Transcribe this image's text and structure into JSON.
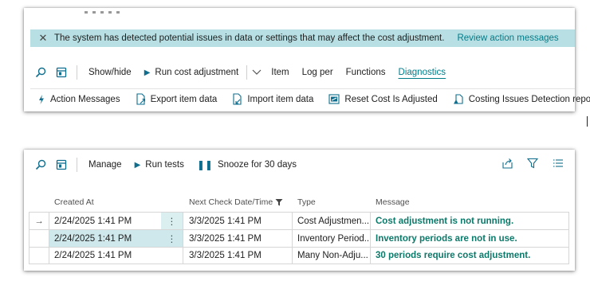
{
  "banner": {
    "message": "The system has detected potential issues in data or settings that may affect the cost adjustment.",
    "link": "Review action messages"
  },
  "toolbar1": {
    "show_hide": "Show/hide",
    "run_cost_adjustment": "Run cost adjustment",
    "item": "Item",
    "log_per": "Log per",
    "functions": "Functions",
    "diagnostics": "Diagnostics"
  },
  "diagnostics_actions": {
    "action_messages": "Action Messages",
    "export_item_data": "Export item data",
    "import_item_data": "Import item data",
    "reset_cost": "Reset Cost Is Adjusted",
    "detection_report": "Costing Issues Detection report"
  },
  "toolbar2": {
    "manage": "Manage",
    "run_tests": "Run tests",
    "snooze": "Snooze for 30 days"
  },
  "table": {
    "headers": {
      "created_at": "Created At",
      "next_check": "Next Check Date/Time",
      "type": "Type",
      "message": "Message"
    },
    "rows": [
      {
        "created_at": "2/24/2025 1:41 PM",
        "next_check": "3/3/2025 1:41 PM",
        "type": "Cost Adjustmen...",
        "message": "Cost adjustment is not running."
      },
      {
        "created_at": "2/24/2025 1:41 PM",
        "next_check": "3/3/2025 1:41 PM",
        "type": "Inventory Period...",
        "message": "Inventory periods are not in use."
      },
      {
        "created_at": "2/24/2025 1:41 PM",
        "next_check": "3/3/2025 1:41 PM",
        "type": "Many Non-Adju...",
        "message": "30 periods require cost adjustment."
      }
    ]
  },
  "colors": {
    "accent": "#007c89",
    "banner_bg": "#b8e0e4",
    "message_text": "#0b7a6a"
  }
}
